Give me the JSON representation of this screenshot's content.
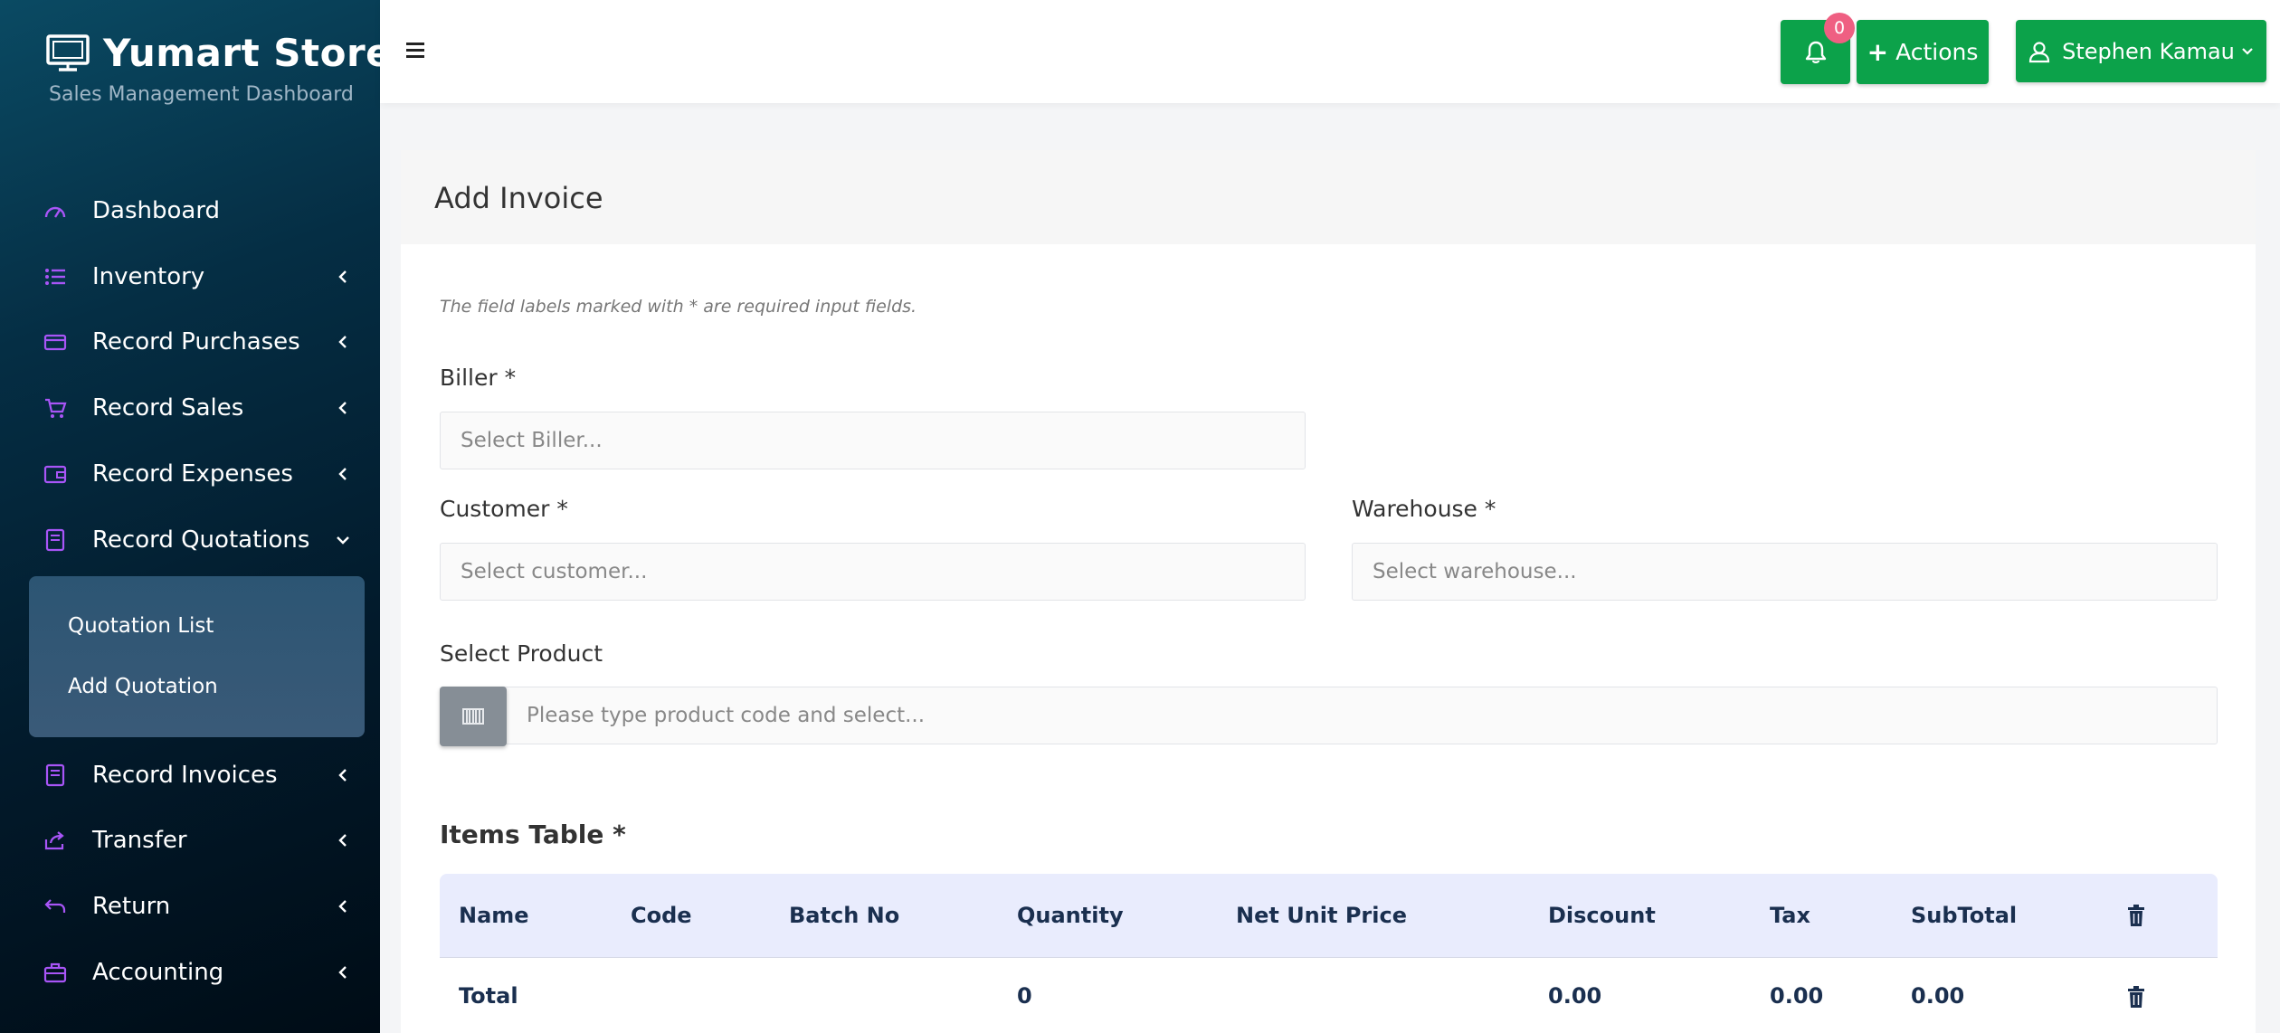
{
  "brand": {
    "title": "Yumart Stores",
    "subtitle": "Sales Management Dashboard"
  },
  "sidebar": {
    "items": [
      {
        "label": "Dashboard",
        "icon": "speedometer-icon"
      },
      {
        "label": "Inventory",
        "icon": "list-icon"
      },
      {
        "label": "Record Purchases",
        "icon": "credit-card-icon"
      },
      {
        "label": "Record Sales",
        "icon": "cart-icon"
      },
      {
        "label": "Record Expenses",
        "icon": "wallet-icon"
      },
      {
        "label": "Record Quotations",
        "icon": "document-icon"
      },
      {
        "label": "Record Invoices",
        "icon": "document-icon"
      },
      {
        "label": "Transfer",
        "icon": "share-icon"
      },
      {
        "label": "Return",
        "icon": "return-icon"
      },
      {
        "label": "Accounting",
        "icon": "briefcase-icon"
      }
    ],
    "submenu": [
      "Quotation List",
      "Add Quotation"
    ]
  },
  "topbar": {
    "notification_count": "0",
    "actions_label": "Actions",
    "user_name": "Stephen Kamau"
  },
  "form": {
    "title": "Add Invoice",
    "note": "The field labels marked with * are required input fields.",
    "biller_label": "Biller *",
    "biller_placeholder": "Select Biller...",
    "customer_label": "Customer *",
    "customer_placeholder": "Select customer...",
    "warehouse_label": "Warehouse *",
    "warehouse_placeholder": "Select warehouse...",
    "product_label": "Select Product",
    "product_placeholder": "Please type product code and select..."
  },
  "table": {
    "title": "Items Table *",
    "headers": [
      "Name",
      "Code",
      "Batch No",
      "Quantity",
      "Net Unit Price",
      "Discount",
      "Tax",
      "SubTotal"
    ],
    "footer": {
      "label": "Total",
      "quantity": "0",
      "discount": "0.00",
      "tax": "0.00",
      "subtotal": "0.00"
    }
  },
  "colors": {
    "accent_green": "#0ca24a",
    "sidebar_icon": "#a855f7",
    "badge": "#ef5f82",
    "table_header": "#e9ecfd"
  }
}
